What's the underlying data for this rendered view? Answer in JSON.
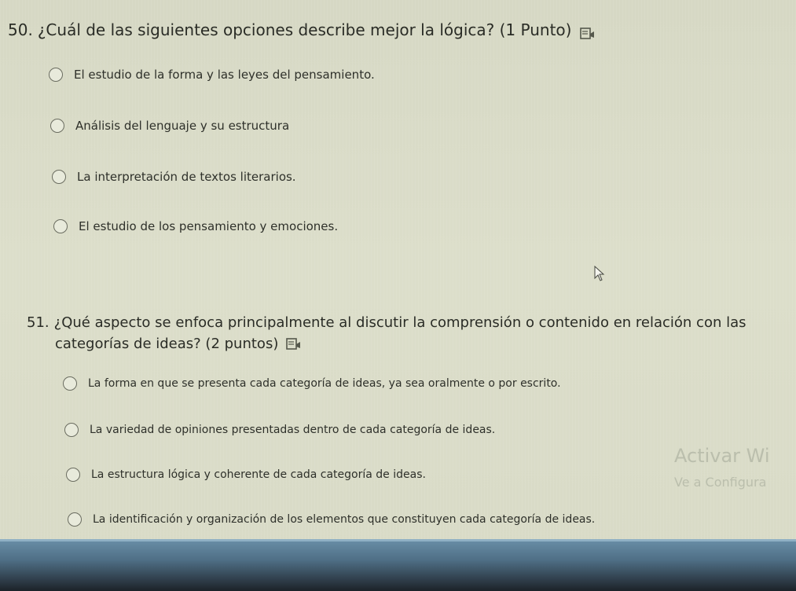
{
  "questions": [
    {
      "number": "50.",
      "text": "¿Cuál de las siguientes opciones describe mejor la lógica? (1 Punto)",
      "options": [
        "El estudio de la forma y las leyes del pensamiento.",
        "Análisis del lenguaje y su estructura",
        "La interpretación de textos literarios.",
        "El estudio de los pensamiento y emociones."
      ]
    },
    {
      "number": "51.",
      "text_line1": "¿Qué aspecto se enfoca principalmente al discutir la comprensión o contenido en relación con las",
      "text_line2": "categorías de ideas? (2 puntos)",
      "options": [
        "La forma en que se presenta cada categoría de ideas, ya sea oralmente o por escrito.",
        "La variedad de opiniones presentadas dentro de cada categoría de ideas.",
        "La estructura lógica y coherente de cada categoría de ideas.",
        "La identificación y organización de los elementos que constituyen cada categoría de ideas."
      ]
    }
  ],
  "watermark": {
    "line1": "Activar Wi",
    "line2": "Ve a Configura"
  },
  "icons": {
    "reader": "immersive-reader-icon",
    "cursor": "mouse-pointer-icon"
  },
  "colors": {
    "background": "#dadcc8",
    "text": "#2e302a",
    "taskbar": "#4f6f86"
  }
}
